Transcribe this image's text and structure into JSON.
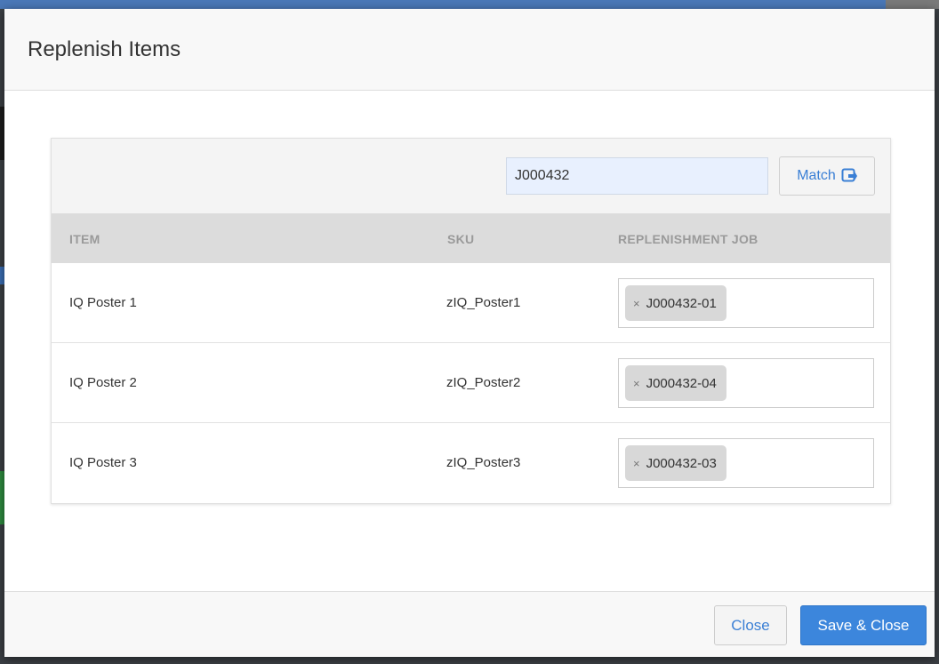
{
  "modal": {
    "title": "Replenish Items"
  },
  "toolbar": {
    "job_input_value": "J000432",
    "match_label": "Match",
    "match_icon": "match-icon"
  },
  "table": {
    "headers": [
      "ITEM",
      "SKU",
      "REPLENISHMENT JOB"
    ],
    "rows": [
      {
        "item": "IQ Poster 1",
        "sku": "zIQ_Poster1",
        "job": "J000432-01",
        "remove": "×"
      },
      {
        "item": "IQ Poster 2",
        "sku": "zIQ_Poster2",
        "job": "J000432-04",
        "remove": "×"
      },
      {
        "item": "IQ Poster 3",
        "sku": "zIQ_Poster3",
        "job": "J000432-03",
        "remove": "×"
      }
    ]
  },
  "footer": {
    "close_label": "Close",
    "save_label": "Save & Close"
  },
  "colors": {
    "accent": "#3c86dc",
    "link": "#3a7fd5",
    "input_bg": "#e8f0fe"
  }
}
